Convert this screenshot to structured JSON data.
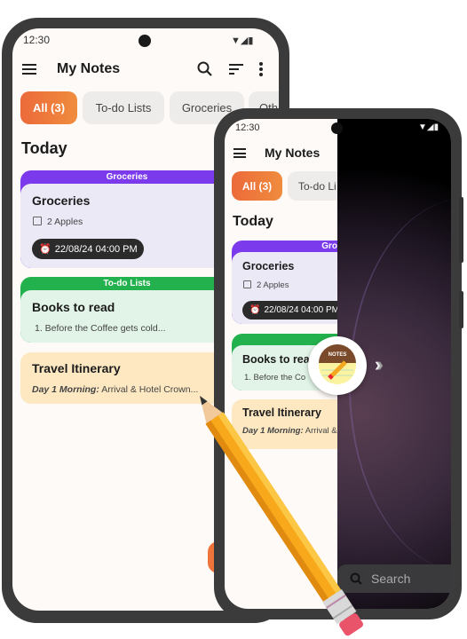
{
  "status": {
    "time": "12:30"
  },
  "app": {
    "title": "My Notes"
  },
  "chips": [
    {
      "label": "All (3)",
      "active": true
    },
    {
      "label": "To-do Lists"
    },
    {
      "label": "Groceries"
    },
    {
      "label": "Oth"
    }
  ],
  "right_chips": [
    {
      "label": "All (3)"
    },
    {
      "label": "To-do Li"
    }
  ],
  "section": "Today",
  "notes": [
    {
      "category": "Groceries",
      "title": "Groceries",
      "item": "2 Apples",
      "reminder": "22/08/24 04:00 PM",
      "color": "#7c3aed",
      "bg": "#ece9f6"
    },
    {
      "category": "To-do Lists",
      "title": "Books to read",
      "item": "1. Before the Coffee gets cold...",
      "color": "#22b14c",
      "bg": "#e2f4e7"
    },
    {
      "title": "Travel Itinerary",
      "label": "Day 1 Morning:",
      "text": "Arrival & Hotel Crown...",
      "bg": "#fde8c2"
    }
  ],
  "right_notes": {
    "cat1": "Gro",
    "title2": "Books to rea",
    "item2": "1. Before the Co",
    "text3": "Arrival &"
  },
  "logo": {
    "text": "NOTES"
  },
  "search": {
    "placeholder": "Search"
  },
  "colors": {
    "accent": "#ee743c",
    "frame": "#3b3b3b"
  }
}
